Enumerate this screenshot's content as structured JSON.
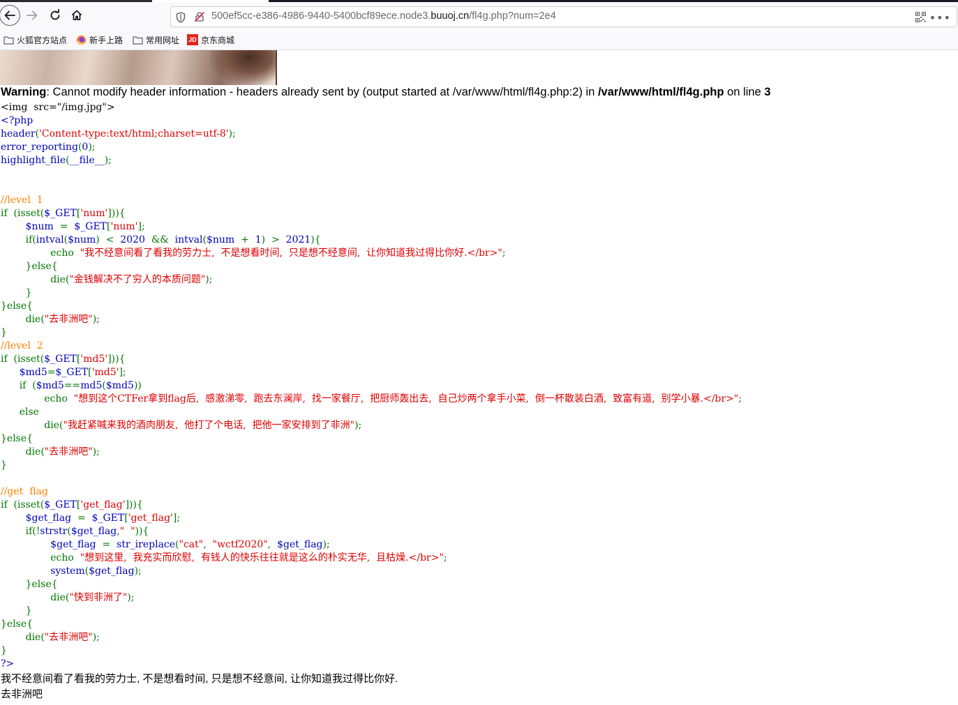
{
  "browser": {
    "url_prefix": "500ef5cc-e386-4986-9440-5400bcf89ece.node3.",
    "url_domain": "buuoj.cn",
    "url_suffix": "/fl4g.php?num=2e4",
    "bookmarks": [
      {
        "label": "火狐官方站点",
        "icon": "folder-icon"
      },
      {
        "label": "新手上路",
        "icon": "firefox-icon"
      },
      {
        "label": "常用网址",
        "icon": "folder-icon"
      },
      {
        "label": "京东商城",
        "icon": "jd-icon"
      }
    ],
    "menu_glyph": "•••",
    "jd_text": "JD"
  },
  "warning": {
    "label": "Warning",
    "message": ": Cannot modify header information - headers already sent by (output started at /var/www/html/fl4g.php:2) in ",
    "file": "/var/www/html/fl4g.php",
    "on_line": " on line ",
    "line": "3"
  },
  "code_lines": [
    [
      {
        "t": "h",
        "v": "<img  src=\"/img.jpg\">"
      }
    ],
    [
      {
        "t": "d",
        "v": "<?php"
      }
    ],
    [
      {
        "t": "d",
        "v": "header"
      },
      {
        "t": "k",
        "v": "("
      },
      {
        "t": "s",
        "v": "'Content-type:text/html;charset=utf-8'"
      },
      {
        "t": "k",
        "v": ");"
      }
    ],
    [
      {
        "t": "d",
        "v": "error_reporting"
      },
      {
        "t": "k",
        "v": "("
      },
      {
        "t": "d",
        "v": "0"
      },
      {
        "t": "k",
        "v": ");"
      }
    ],
    [
      {
        "t": "d",
        "v": "highlight_file"
      },
      {
        "t": "k",
        "v": "("
      },
      {
        "t": "d",
        "v": "__file__"
      },
      {
        "t": "k",
        "v": ");"
      }
    ],
    [],
    [],
    [
      {
        "t": "c",
        "v": "//level  1"
      }
    ],
    [
      {
        "t": "k",
        "v": "if  (isset("
      },
      {
        "t": "d",
        "v": "$_GET"
      },
      {
        "t": "k",
        "v": "["
      },
      {
        "t": "s",
        "v": "'num'"
      },
      {
        "t": "k",
        "v": "])){"
      }
    ],
    [
      {
        "t": "k",
        "v": "        "
      },
      {
        "t": "d",
        "v": "$num"
      },
      {
        "t": "k",
        "v": "  =  "
      },
      {
        "t": "d",
        "v": "$_GET"
      },
      {
        "t": "k",
        "v": "["
      },
      {
        "t": "s",
        "v": "'num'"
      },
      {
        "t": "k",
        "v": "];"
      }
    ],
    [
      {
        "t": "k",
        "v": "        if("
      },
      {
        "t": "d",
        "v": "intval"
      },
      {
        "t": "k",
        "v": "("
      },
      {
        "t": "d",
        "v": "$num"
      },
      {
        "t": "k",
        "v": ")  <  "
      },
      {
        "t": "d",
        "v": "2020"
      },
      {
        "t": "k",
        "v": "  &&  "
      },
      {
        "t": "d",
        "v": "intval"
      },
      {
        "t": "k",
        "v": "("
      },
      {
        "t": "d",
        "v": "$num"
      },
      {
        "t": "k",
        "v": "  +  "
      },
      {
        "t": "d",
        "v": "1"
      },
      {
        "t": "k",
        "v": ")  >  "
      },
      {
        "t": "d",
        "v": "2021"
      },
      {
        "t": "k",
        "v": "){"
      }
    ],
    [
      {
        "t": "k",
        "v": "                echo  "
      },
      {
        "t": "s",
        "v": "\"我不经意间看了看我的劳力士,  不是想看时间,  只是想不经意间,  让你知道我过得比你好.</br>\""
      },
      {
        "t": "k",
        "v": ";"
      }
    ],
    [
      {
        "t": "k",
        "v": "        }else{"
      }
    ],
    [
      {
        "t": "k",
        "v": "                die("
      },
      {
        "t": "s",
        "v": "\"金钱解决不了穷人的本质问题\""
      },
      {
        "t": "k",
        "v": ");"
      }
    ],
    [
      {
        "t": "k",
        "v": "        }"
      }
    ],
    [
      {
        "t": "k",
        "v": "}else{"
      }
    ],
    [
      {
        "t": "k",
        "v": "        die("
      },
      {
        "t": "s",
        "v": "\"去非洲吧\""
      },
      {
        "t": "k",
        "v": ");"
      }
    ],
    [
      {
        "t": "k",
        "v": "}"
      }
    ],
    [
      {
        "t": "c",
        "v": "//level  2"
      }
    ],
    [
      {
        "t": "k",
        "v": "if  (isset("
      },
      {
        "t": "d",
        "v": "$_GET"
      },
      {
        "t": "k",
        "v": "["
      },
      {
        "t": "s",
        "v": "'md5'"
      },
      {
        "t": "k",
        "v": "])){"
      }
    ],
    [
      {
        "t": "k",
        "v": "      "
      },
      {
        "t": "d",
        "v": "$md5"
      },
      {
        "t": "k",
        "v": "="
      },
      {
        "t": "d",
        "v": "$_GET"
      },
      {
        "t": "k",
        "v": "["
      },
      {
        "t": "s",
        "v": "'md5'"
      },
      {
        "t": "k",
        "v": "];"
      }
    ],
    [
      {
        "t": "k",
        "v": "      if  ("
      },
      {
        "t": "d",
        "v": "$md5"
      },
      {
        "t": "k",
        "v": "=="
      },
      {
        "t": "d",
        "v": "md5"
      },
      {
        "t": "k",
        "v": "("
      },
      {
        "t": "d",
        "v": "$md5"
      },
      {
        "t": "k",
        "v": "))"
      }
    ],
    [
      {
        "t": "k",
        "v": "              echo  "
      },
      {
        "t": "s",
        "v": "\"想到这个CTFer拿到flag后,  感激涕零,  跑去东澜岸,  找一家餐厅,  把厨师轰出去,  自己炒两个拿手小菜,  倒一杯散装白酒,  致富有道,  别学小暴.</br>\""
      },
      {
        "t": "k",
        "v": ";"
      }
    ],
    [
      {
        "t": "k",
        "v": "      else"
      }
    ],
    [
      {
        "t": "k",
        "v": "              die("
      },
      {
        "t": "s",
        "v": "\"我赶紧喊来我的酒肉朋友,  他打了个电话,  把他一家安排到了非洲\""
      },
      {
        "t": "k",
        "v": ");"
      }
    ],
    [
      {
        "t": "k",
        "v": "}else{"
      }
    ],
    [
      {
        "t": "k",
        "v": "        die("
      },
      {
        "t": "s",
        "v": "\"去非洲吧\""
      },
      {
        "t": "k",
        "v": ");"
      }
    ],
    [
      {
        "t": "k",
        "v": "}"
      }
    ],
    [],
    [
      {
        "t": "c",
        "v": "//get  flag"
      }
    ],
    [
      {
        "t": "k",
        "v": "if  (isset("
      },
      {
        "t": "d",
        "v": "$_GET"
      },
      {
        "t": "k",
        "v": "["
      },
      {
        "t": "s",
        "v": "'get_flag'"
      },
      {
        "t": "k",
        "v": "])){"
      }
    ],
    [
      {
        "t": "k",
        "v": "        "
      },
      {
        "t": "d",
        "v": "$get_flag"
      },
      {
        "t": "k",
        "v": "  =  "
      },
      {
        "t": "d",
        "v": "$_GET"
      },
      {
        "t": "k",
        "v": "["
      },
      {
        "t": "s",
        "v": "'get_flag'"
      },
      {
        "t": "k",
        "v": "];"
      }
    ],
    [
      {
        "t": "k",
        "v": "        if(!"
      },
      {
        "t": "d",
        "v": "strstr"
      },
      {
        "t": "k",
        "v": "("
      },
      {
        "t": "d",
        "v": "$get_flag"
      },
      {
        "t": "k",
        "v": ","
      },
      {
        "t": "s",
        "v": "\"  \""
      },
      {
        "t": "k",
        "v": ")){"
      }
    ],
    [
      {
        "t": "k",
        "v": "                "
      },
      {
        "t": "d",
        "v": "$get_flag"
      },
      {
        "t": "k",
        "v": "  =  "
      },
      {
        "t": "d",
        "v": "str_ireplace"
      },
      {
        "t": "k",
        "v": "("
      },
      {
        "t": "s",
        "v": "\"cat\""
      },
      {
        "t": "k",
        "v": ",  "
      },
      {
        "t": "s",
        "v": "\"wctf2020\""
      },
      {
        "t": "k",
        "v": ",  "
      },
      {
        "t": "d",
        "v": "$get_flag"
      },
      {
        "t": "k",
        "v": ");"
      }
    ],
    [
      {
        "t": "k",
        "v": "                echo  "
      },
      {
        "t": "s",
        "v": "\"想到这里,  我充实而欣慰,  有钱人的快乐往往就是这么的朴实无华,  且枯燥.</br>\""
      },
      {
        "t": "k",
        "v": ";"
      }
    ],
    [
      {
        "t": "k",
        "v": "                "
      },
      {
        "t": "d",
        "v": "system"
      },
      {
        "t": "k",
        "v": "("
      },
      {
        "t": "d",
        "v": "$get_flag"
      },
      {
        "t": "k",
        "v": ");"
      }
    ],
    [
      {
        "t": "k",
        "v": "        }else{"
      }
    ],
    [
      {
        "t": "k",
        "v": "                die("
      },
      {
        "t": "s",
        "v": "\"快到非洲了\""
      },
      {
        "t": "k",
        "v": ");"
      }
    ],
    [
      {
        "t": "k",
        "v": "        }"
      }
    ],
    [
      {
        "t": "k",
        "v": "}else{"
      }
    ],
    [
      {
        "t": "k",
        "v": "        die("
      },
      {
        "t": "s",
        "v": "\"去非洲吧\""
      },
      {
        "t": "k",
        "v": ");"
      }
    ],
    [
      {
        "t": "k",
        "v": "}"
      }
    ],
    [
      {
        "t": "d",
        "v": "?>"
      }
    ]
  ],
  "output_lines": [
    "我不经意间看了看我的劳力士, 不是想看时间, 只是想不经意间, 让你知道我过得比你好.",
    "去非洲吧"
  ],
  "colors": {
    "keyword": "#007700",
    "default": "#0000bb",
    "string": "#dd0000",
    "comment": "#ff8000"
  }
}
